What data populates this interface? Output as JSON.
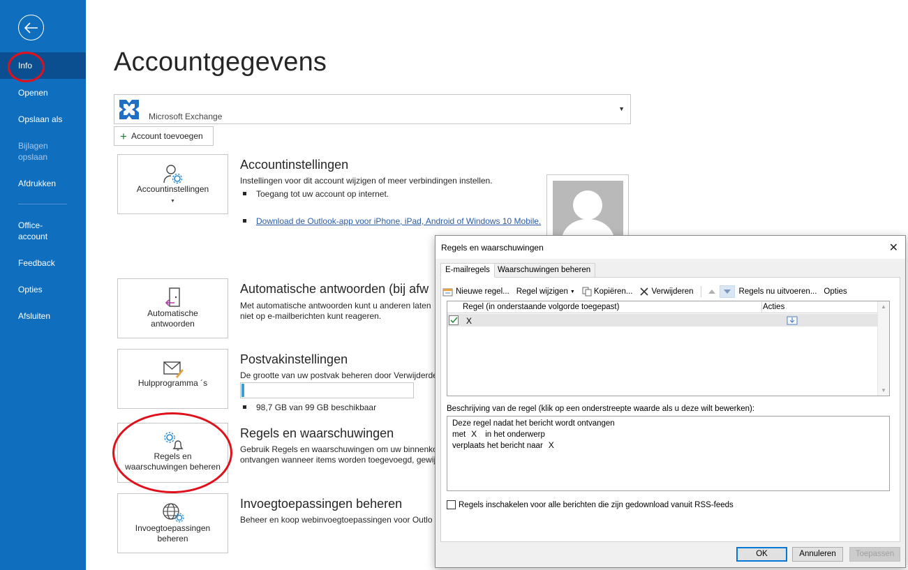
{
  "sidebar": {
    "items": [
      {
        "label": "Info",
        "state": "active"
      },
      {
        "label": "Openen"
      },
      {
        "label": "Opslaan als"
      },
      {
        "label": "Bijlagen opslaan",
        "state": "disabled"
      },
      {
        "label": "Afdrukken"
      },
      {
        "label": "Office-account"
      },
      {
        "label": "Feedback"
      },
      {
        "label": "Opties"
      },
      {
        "label": "Afsluiten"
      }
    ],
    "bg_color": "#106ebe",
    "active_color": "#0b4f91",
    "annotation_color": "#e0111b"
  },
  "main": {
    "title": "Accountgegevens",
    "account_select": {
      "name": "Microsoft Exchange",
      "icon": "exchange-logo"
    },
    "add_account_label": "Account toevoegen",
    "tiles": [
      {
        "label": "Accountinstellingen",
        "icon": "account-settings-icon"
      },
      {
        "label": "Automatische antwoorden",
        "icon": "auto-reply-icon"
      },
      {
        "label": "Hulpprogramma ´s",
        "icon": "tools-icon"
      },
      {
        "label": "Regels en waarschuwingen beheren",
        "icon": "rules-alerts-icon"
      },
      {
        "label": "Invoegtoepassingen beheren",
        "icon": "addins-icon"
      }
    ],
    "sections": {
      "account_settings": {
        "title": "Accountinstellingen",
        "text": "Instellingen voor dit account wijzigen of meer verbindingen instellen.",
        "bullet1": "Toegang tot uw account op internet.",
        "link": "Download de Outlook-app voor iPhone, iPad, Android of Windows 10 Mobile."
      },
      "auto_reply": {
        "title": "Automatische antwoorden (bij afw",
        "line1": "Met automatische antwoorden kunt u anderen laten",
        "line2": "niet op e-mailberichten kunt reageren."
      },
      "mailbox": {
        "title": "Postvakinstellingen",
        "text": "De grootte van uw postvak beheren door Verwijderde",
        "quota": "98,7 GB van 99 GB beschikbaar",
        "used_fraction": 0.003
      },
      "rules": {
        "title": "Regels en waarschuwingen",
        "line1": "Gebruik Regels en waarschuwingen om uw binnenko",
        "line2": "ontvangen wanneer items worden toegevoegd, gewij"
      },
      "addins": {
        "title": "Invoegtoepassingen beheren",
        "text": "Beheer en koop webinvoegtoepassingen voor Outlo"
      }
    }
  },
  "dialog": {
    "title": "Regels en waarschuwingen",
    "tabs": [
      "E-mailregels",
      "Waarschuwingen beheren"
    ],
    "toolbar": {
      "new_rule": "Nieuwe regel...",
      "change_rule": "Regel wijzigen",
      "copy": "Kopiëren...",
      "delete": "Verwijderen",
      "run_now": "Regels nu uitvoeren...",
      "options": "Opties"
    },
    "list": {
      "col_rule": "Regel (in onderstaande volgorde toegepast)",
      "col_actions": "Acties",
      "rows": [
        {
          "name": "X",
          "checked": true
        }
      ]
    },
    "description": {
      "label": "Beschrijving van de regel (klik op een onderstreepte waarde als u deze wilt bewerken):",
      "line1": "Deze regel nadat het bericht wordt ontvangen",
      "line2_a": "met",
      "line2_x": "X",
      "line2_b": "in het onderwerp",
      "line3_a": "verplaats het bericht naar",
      "line3_x": "X"
    },
    "rss_label": "Regels inschakelen voor alle berichten die zijn gedownload vanuit RSS-feeds",
    "buttons": {
      "ok": "OK",
      "cancel": "Annuleren",
      "apply": "Toepassen"
    }
  }
}
